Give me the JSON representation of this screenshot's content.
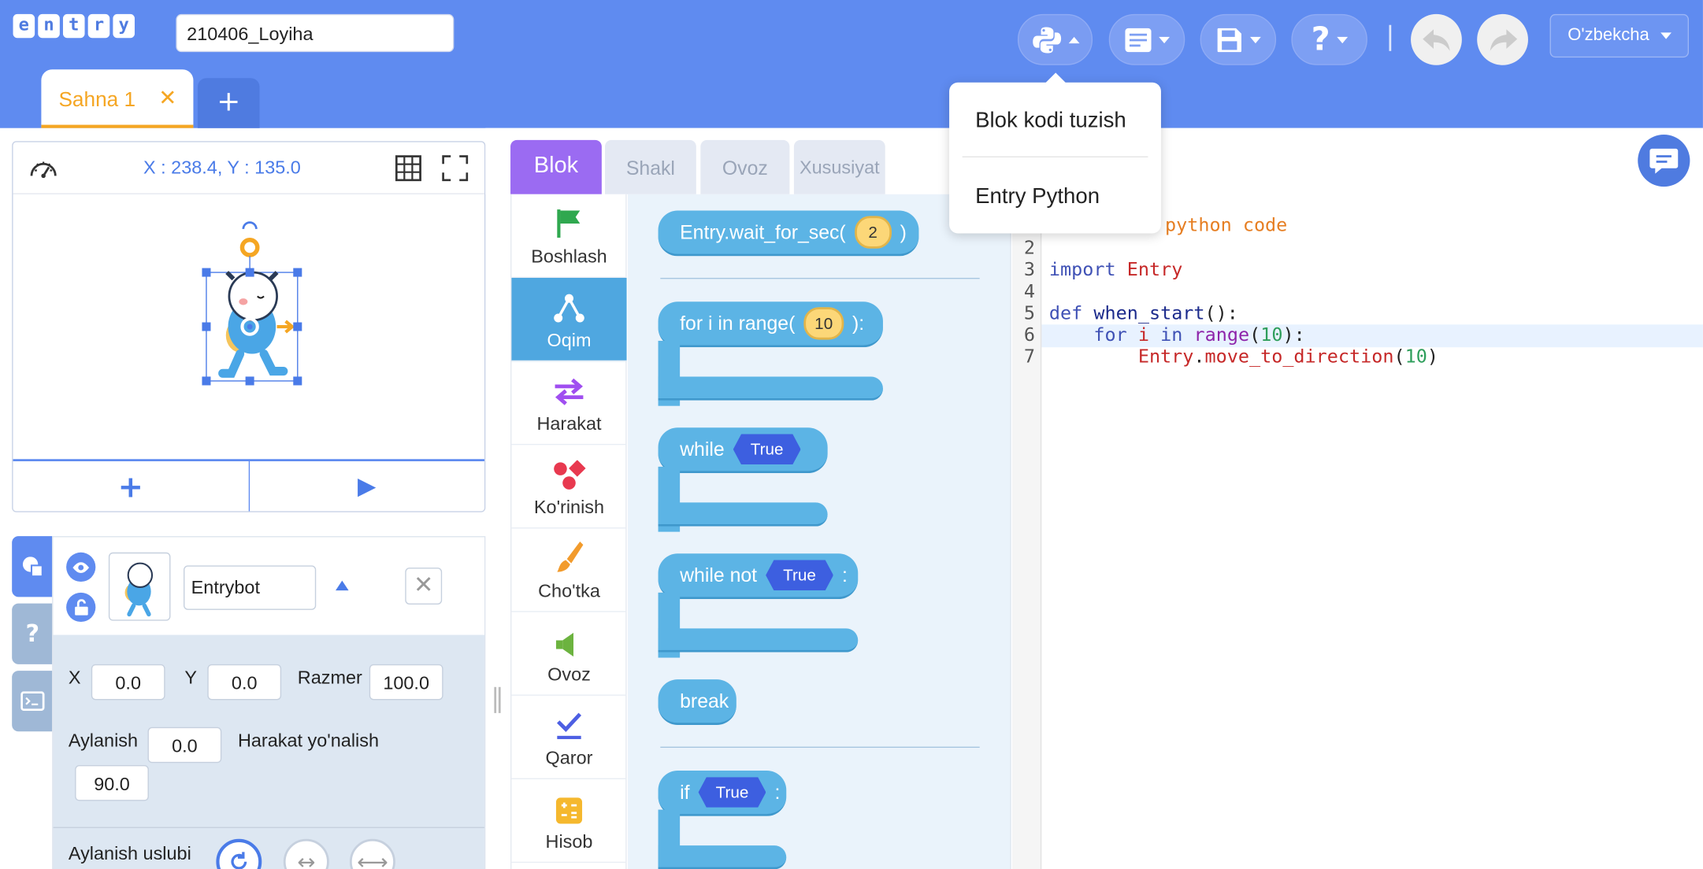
{
  "header": {
    "logo_letters": [
      "e",
      "n",
      "t",
      "r",
      "y"
    ],
    "project_name": "210406_Loyiha",
    "language": "O'zbekcha",
    "icons": [
      "python-icon",
      "script-icon",
      "save-icon",
      "help-icon",
      "undo-icon",
      "redo-icon"
    ]
  },
  "scene_tabs": {
    "active_label": "Sahna 1",
    "close": "✕",
    "add": "+"
  },
  "stage": {
    "coords": "X : 238.4, Y : 135.0",
    "add_label": "+",
    "run_label": "▶"
  },
  "object": {
    "name": "Entrybot",
    "x_label": "X",
    "x_value": "0.0",
    "y_label": "Y",
    "y_value": "0.0",
    "size_label": "Razmer",
    "size_value": "100.0",
    "rotation_label": "Aylanish",
    "rotation_value": "0.0",
    "direction_label": "Harakat yo'nalish",
    "direction_value": "90.0",
    "rotation_style_label": "Aylanish uslubi"
  },
  "block_tabs": [
    "Blok",
    "Shakl",
    "Ovoz",
    "Xususiyat"
  ],
  "categories": [
    {
      "label": "Boshlash",
      "color": "#2fa84f"
    },
    {
      "label": "Oqim",
      "color": "#ffffff"
    },
    {
      "label": "Harakat",
      "color": "#a04ef0"
    },
    {
      "label": "Ko'rinish",
      "color": "#e8394f"
    },
    {
      "label": "Cho'tka",
      "color": "#f29b2c"
    },
    {
      "label": "Ovoz",
      "color": "#6cb33f"
    },
    {
      "label": "Qaror",
      "color": "#4d5fe3"
    },
    {
      "label": "Hisob",
      "color": "#f5b82e"
    }
  ],
  "blocks": {
    "wait": {
      "text": "Entry.wait_for_sec(",
      "arg": "2",
      "end": ")"
    },
    "for": {
      "text": "for i in range(",
      "arg": "10",
      "end": "):"
    },
    "while": {
      "text": "while",
      "arg": "True",
      "end": ":"
    },
    "while_not": {
      "text": "while not",
      "arg": "True",
      "end": ":"
    },
    "break": {
      "text": "break"
    },
    "if": {
      "text": "if",
      "arg": "True",
      "end": ":"
    }
  },
  "code": {
    "line_numbers": [
      "1",
      "2",
      "3",
      "4",
      "5",
      "6",
      "7"
    ],
    "comment_fragment": "'s python code",
    "line3_kw": "import",
    "line3_mod": "Entry",
    "line5_kw": "def",
    "line5_fn": "when_start",
    "line5_end": "():",
    "line6_for": "for",
    "line6_i": "i",
    "line6_in": "in",
    "line6_range": "range",
    "line6_num": "10",
    "line6_end": "):",
    "line7_call": "Entry",
    "line7_fn": "move_to_direction",
    "line7_num": "10"
  },
  "dropdown": {
    "items": [
      "Blok kodi tuzish",
      "Entry Python"
    ]
  },
  "colors": {
    "header": "#5f8bf0",
    "accent_orange": "#f5a623",
    "block_blue": "#5cb4e5",
    "tab_purple": "#9b6bf2"
  }
}
